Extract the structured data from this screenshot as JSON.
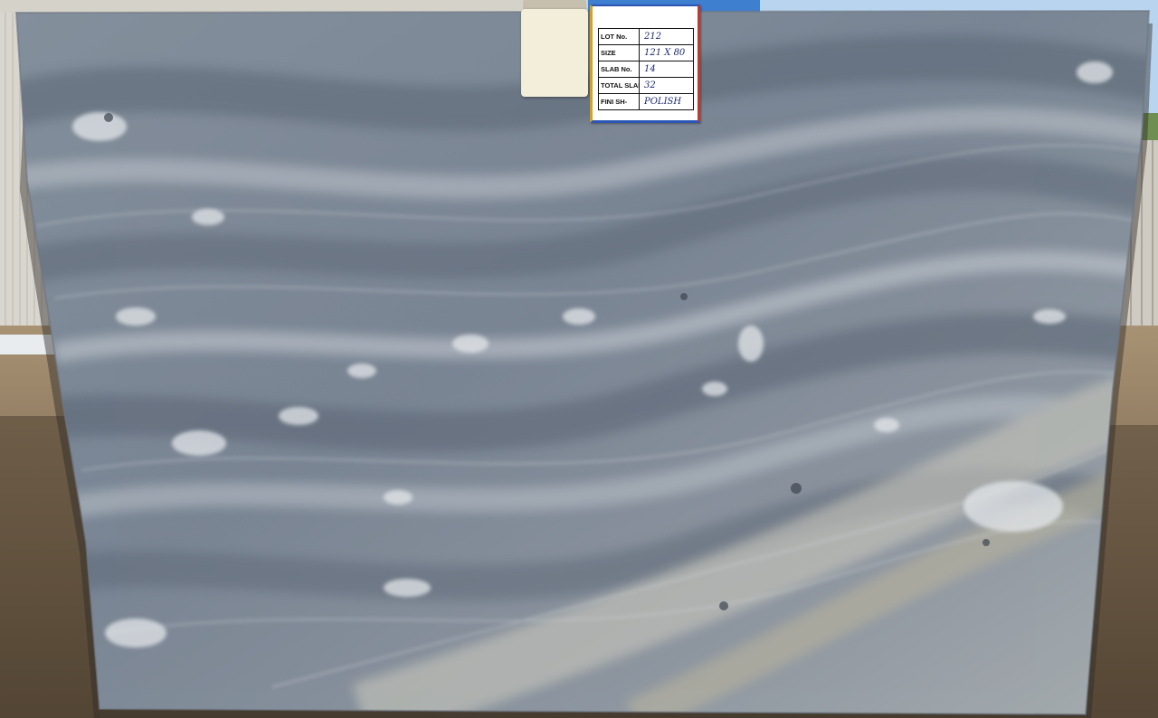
{
  "scene": {
    "subject": "granite-slab",
    "colors": {
      "sky": "#b8d4ee",
      "ground": "#6b5a45",
      "slab_base": "#7f8a98",
      "slab_light": "#c3c9d0",
      "slab_dark": "#5c6675",
      "tag_border_yellow": "#d6a21e",
      "tag_border_red": "#c0392b",
      "tag_border_blue": "#2a56b5"
    }
  },
  "lot_tag": {
    "rows": [
      {
        "label": "LOT No.",
        "value": "212"
      },
      {
        "label": "SIZE",
        "value": "121 X 80"
      },
      {
        "label": "SLAB No.",
        "value": "14"
      },
      {
        "label": "TOTAL SLAB",
        "value": "32"
      },
      {
        "label": "FINI SH-",
        "value": "POLISH"
      }
    ]
  }
}
